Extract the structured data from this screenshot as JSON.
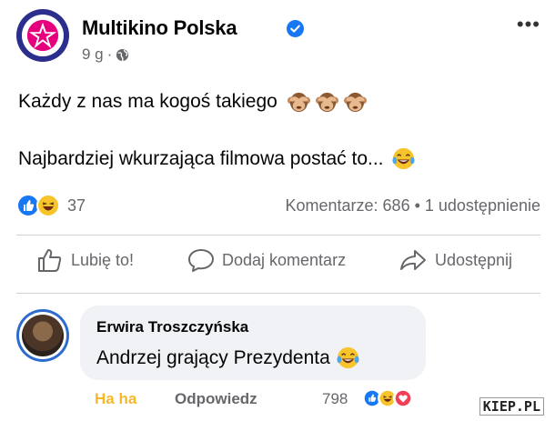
{
  "post": {
    "page_name": "Multikino Polska",
    "verified_icon": "verified-badge-icon",
    "time": "9 g",
    "separator": "·",
    "privacy_icon": "globe-icon",
    "more_label": "•••",
    "text_line1": "Każdy z nas ma kogoś takiego",
    "text_line1_emoji": [
      "see-no-evil-monkey",
      "see-no-evil-monkey",
      "see-no-evil-monkey"
    ],
    "text_line2": "Najbardziej wkurzająca filmowa postać to...",
    "text_line2_emoji": "laughing-with-tears"
  },
  "stats": {
    "reactions": [
      "like",
      "haha"
    ],
    "reaction_count": "37",
    "comments_shares": "Komentarze: 686 • 1 udostępnienie"
  },
  "actions": {
    "like": "Lubię to!",
    "comment": "Dodaj komentarz",
    "share": "Udostępnij"
  },
  "comment": {
    "author": "Erwira Troszczyńska",
    "text": "Andrzej grający Prezydenta",
    "emoji": "laughing-with-tears",
    "reaction_label": "Ha ha",
    "reply_label": "Odpowiedz",
    "reaction_count": "798",
    "reactions": [
      "like",
      "haha",
      "love"
    ]
  },
  "watermark": "KIEP.PL",
  "colors": {
    "brand_magenta": "#e6007e",
    "facebook_blue": "#1877f2",
    "haha_yellow": "#f7b928",
    "love_red": "#f33e58",
    "meta_gray": "#65676b"
  }
}
